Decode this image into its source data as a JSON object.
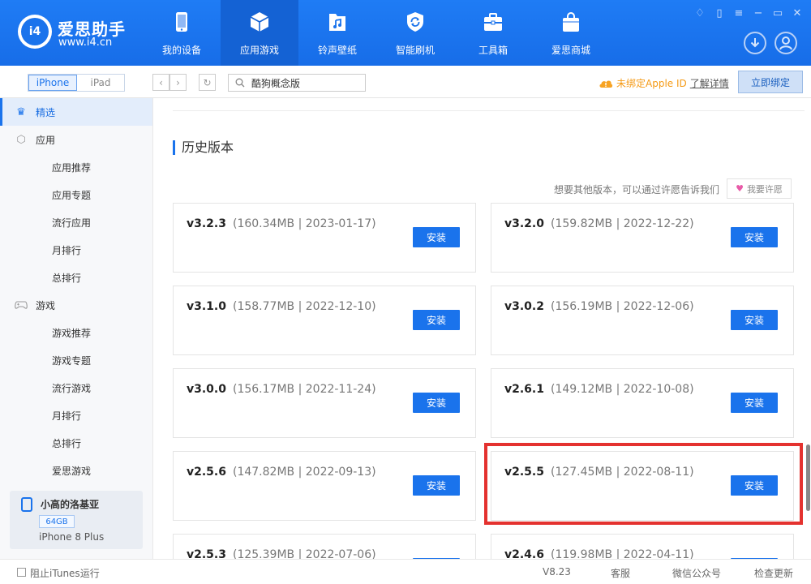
{
  "brand": {
    "title": "爱思助手",
    "url": "www.i4.cn",
    "logo_text": "i4"
  },
  "nav": [
    {
      "label": "我的设备",
      "icon": "phone-icon"
    },
    {
      "label": "应用游戏",
      "icon": "cube-icon"
    },
    {
      "label": "铃声壁纸",
      "icon": "music-folder-icon"
    },
    {
      "label": "智能刷机",
      "icon": "refresh-shield-icon"
    },
    {
      "label": "工具箱",
      "icon": "toolbox-icon"
    },
    {
      "label": "爱思商城",
      "icon": "shopping-bag-icon"
    }
  ],
  "nav_active": "应用游戏",
  "device_tabs": {
    "iphone": "iPhone",
    "ipad": "iPad"
  },
  "search": {
    "value": "酷狗概念版"
  },
  "apple_id": {
    "warning": "未绑定Apple ID",
    "link": "了解详情",
    "bind": "立即绑定"
  },
  "sidebar": {
    "featured": "精选",
    "apps": "应用",
    "app_items": [
      "应用推荐",
      "应用专题",
      "流行应用",
      "月排行",
      "总排行"
    ],
    "games": "游戏",
    "game_items": [
      "游戏推荐",
      "游戏专题",
      "流行游戏",
      "月排行",
      "总排行",
      "爱思游戏"
    ]
  },
  "device": {
    "name": "小高的洛基亚",
    "storage": "64GB",
    "model": "iPhone 8 Plus"
  },
  "history": {
    "title": "历史版本",
    "wish_text": "想要其他版本，可以通过许愿告诉我们",
    "wish_button": "我要许愿",
    "install_label": "安装",
    "versions": [
      {
        "ver": "v3.2.3",
        "meta": "(160.34MB | 2023-01-17)"
      },
      {
        "ver": "v3.2.0",
        "meta": "(159.82MB | 2022-12-22)"
      },
      {
        "ver": "v3.1.0",
        "meta": "(158.77MB | 2022-12-10)"
      },
      {
        "ver": "v3.0.2",
        "meta": "(156.19MB | 2022-12-06)"
      },
      {
        "ver": "v3.0.0",
        "meta": "(156.17MB | 2022-11-24)"
      },
      {
        "ver": "v2.6.1",
        "meta": "(149.12MB | 2022-10-08)"
      },
      {
        "ver": "v2.5.6",
        "meta": "(147.82MB | 2022-09-13)"
      },
      {
        "ver": "v2.5.5",
        "meta": "(127.45MB | 2022-08-11)"
      },
      {
        "ver": "v2.5.3",
        "meta": "(125.39MB | 2022-07-06)"
      },
      {
        "ver": "v2.4.6",
        "meta": "(119.98MB | 2022-04-11)"
      }
    ]
  },
  "status": {
    "itunes": "阻止iTunes运行",
    "version": "V8.23",
    "service": "客服",
    "wechat": "微信公众号",
    "update": "检查更新"
  },
  "colors": {
    "primary": "#1a73ec",
    "highlight": "#e4322f",
    "warning": "#f59a15"
  }
}
